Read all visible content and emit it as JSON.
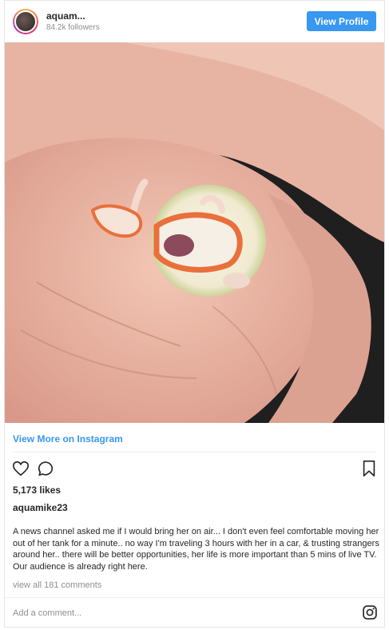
{
  "header": {
    "username": "aquam...",
    "followers": "84.2k followers",
    "view_profile_label": "View Profile"
  },
  "post": {
    "view_more_label": "View More on Instagram",
    "likes": "5,173 likes",
    "author": "aquamike23",
    "caption": "A news channel asked me if I would bring her on air... I don't even feel comfortable moving her out of her tank for a minute.. no way I'm traveling 3 hours with her in a car, & trusting strangers around her.. there will be better opportunities, her life is more important than 5 mins of live TV. Our audience is already right here.",
    "view_all_comments": "view all 181 comments",
    "add_comment_placeholder": "Add a comment..."
  },
  "icons": {
    "like": "heart-icon",
    "comment": "comment-icon",
    "save": "bookmark-icon",
    "instagram": "instagram-icon"
  },
  "colors": {
    "accent": "#3897f0",
    "muted_text": "#8e8e8e",
    "text": "#262626"
  }
}
